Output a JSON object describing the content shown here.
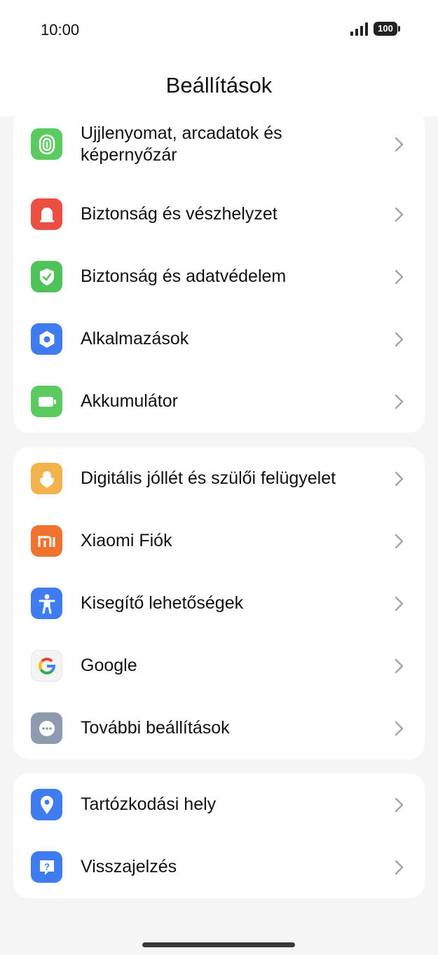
{
  "status": {
    "time": "10:00",
    "battery": "100"
  },
  "header": {
    "title": "Beállítások"
  },
  "groups": [
    {
      "items": [
        {
          "label": "Ujjlenyomat, arcadatok és képernyőzár",
          "icon": "fingerprint-icon",
          "color": "#5ccb5f"
        },
        {
          "label": "Biztonság és vészhelyzet",
          "icon": "emergency-icon",
          "color": "#ea4f42"
        },
        {
          "label": "Biztonság és adatvédelem",
          "icon": "shield-icon",
          "color": "#4fc359"
        },
        {
          "label": "Alkalmazások",
          "icon": "apps-gear-icon",
          "color": "#3f7cf0"
        },
        {
          "label": "Akkumulátor",
          "icon": "battery-icon",
          "color": "#5ccb5f"
        }
      ]
    },
    {
      "items": [
        {
          "label": "Digitális jóllét és szülői felügyelet",
          "icon": "wellbeing-icon",
          "color": "#f2b24c"
        },
        {
          "label": "Xiaomi Fiók",
          "icon": "xiaomi-icon",
          "color": "#f0722f"
        },
        {
          "label": "Kisegítő lehetőségek",
          "icon": "accessibility-icon",
          "color": "#3f7cf0"
        },
        {
          "label": "Google",
          "icon": "google-icon",
          "color": "#f4f4f4"
        },
        {
          "label": "További beállítások",
          "icon": "more-icon",
          "color": "#8e9aae"
        }
      ]
    },
    {
      "items": [
        {
          "label": "Tartózkodási hely",
          "icon": "location-icon",
          "color": "#3f7cf0"
        },
        {
          "label": "Visszajelzés",
          "icon": "feedback-icon",
          "color": "#3f7cf0"
        }
      ]
    }
  ]
}
